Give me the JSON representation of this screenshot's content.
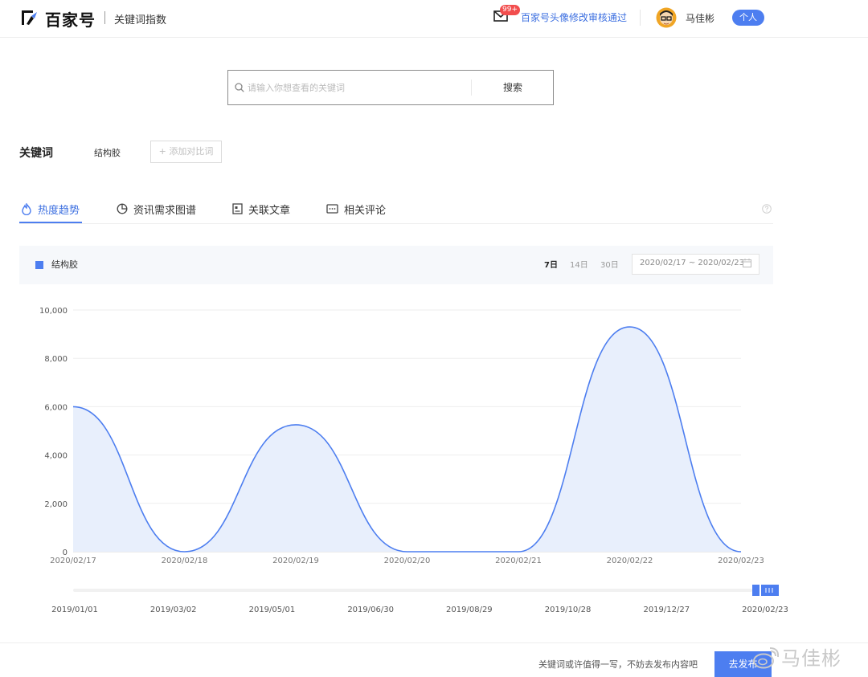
{
  "header": {
    "logo_text": "百家号",
    "subtitle": "关键词指数",
    "mail_badge": "99+",
    "notice": "百家号头像修改审核通过",
    "username": "马佳彬",
    "personal_button": "个人"
  },
  "search": {
    "placeholder": "请输入你想查看的关键词",
    "button": "搜索"
  },
  "keyword": {
    "label": "关键词",
    "value": "结构胶",
    "add_compare": "+ 添加对比词"
  },
  "tabs": [
    {
      "label": "热度趋势",
      "icon": "flame-icon",
      "active": true
    },
    {
      "label": "资讯需求图谱",
      "icon": "pie-icon"
    },
    {
      "label": "关联文章",
      "icon": "article-icon"
    },
    {
      "label": "相关评论",
      "icon": "comment-icon"
    }
  ],
  "chart_toolbar": {
    "legend": "结构胶",
    "ranges": [
      "7日",
      "14日",
      "30日"
    ],
    "selected_range": "7日",
    "date_range": "2020/02/17 ~ 2020/02/23"
  },
  "chart_data": {
    "type": "area",
    "categories": [
      "2020/02/17",
      "2020/02/18",
      "2020/02/19",
      "2020/02/20",
      "2020/02/21",
      "2020/02/22",
      "2020/02/23"
    ],
    "series": [
      {
        "name": "结构胶",
        "values": [
          6000,
          0,
          5250,
          0,
          0,
          9300,
          0
        ]
      }
    ],
    "y_ticks": [
      "0",
      "2,000",
      "4,000",
      "6,000",
      "8,000",
      "10,000"
    ],
    "ylim": [
      0,
      10000
    ],
    "grid": true,
    "legend_position": "top-left",
    "line_color": "#4d7ef0",
    "fill_color": "#e8effc",
    "slider_labels": [
      "2019/01/01",
      "2019/03/02",
      "2019/05/01",
      "2019/06/30",
      "2019/08/29",
      "2019/10/28",
      "2019/12/27",
      "2020/02/23"
    ]
  },
  "footer": {
    "tip": "关键词或许值得一写，不妨去发布内容吧",
    "publish_button": "去发布",
    "watermark": "马佳彬"
  },
  "colors": {
    "accent": "#4d7ef0",
    "notice": "#3c6fe0",
    "badge": "#f24d4d"
  }
}
